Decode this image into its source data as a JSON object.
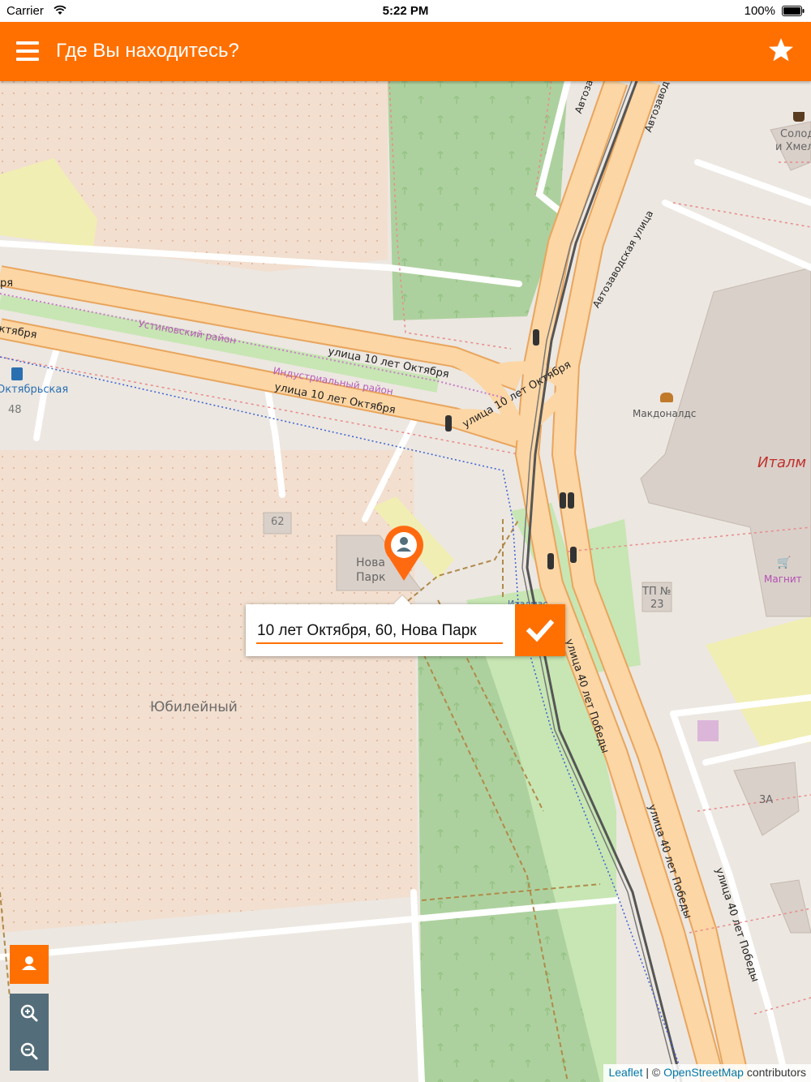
{
  "status_bar": {
    "carrier": "Carrier",
    "time": "5:22 PM",
    "battery": "100%"
  },
  "header": {
    "title": "Где Вы находитесь?",
    "menu_icon": "hamburger-icon",
    "favorite_icon": "star-icon"
  },
  "popup": {
    "address": "10 лет Октября, 60, Нова Парк",
    "confirm_icon": "checkmark-icon"
  },
  "controls": {
    "locate_icon": "user-location-icon",
    "zoom_in_icon": "zoom-in-icon",
    "zoom_out_icon": "zoom-out-icon"
  },
  "attribution": {
    "leaflet": "Leaflet",
    "separator": "| ©",
    "osm": "OpenStreetMap",
    "suffix": "contributors"
  },
  "map_labels": {
    "yubileyny": "Юбилейный",
    "nova_park_1": "Нова",
    "nova_park_2": "Парк",
    "house_62": "62",
    "house_48": "48",
    "oktyabrskaya": "Октябрьская",
    "ustinovsky": "Устиновский район",
    "industrialny": "Индустриальный район",
    "street_10_let_1": "улица 10 лет Октября",
    "street_10_let_2": "улица 10 лет Октября",
    "street_10_let_3": "улица 10 лет Октября",
    "street_10_let_left1": "ря",
    "street_10_let_left2": "ктября",
    "avtozavodskaya": "Автозаводская улица",
    "avtozav_short1": "Автоза",
    "avtozav_short2": "Автозавод",
    "mcdonalds": "Макдоналдс",
    "italmas": "Италм",
    "magnit": "Магнит",
    "tp_23_1": "ТП №",
    "tp_23_2": "23",
    "street_40_let_1": "улица 40 лет Победы",
    "street_40_let_2": "улица 40 лет Победы",
    "street_40_let_3": "улица 40 лет Победы",
    "italmas_stop": "Италмас",
    "house_3a": "3А",
    "solod_1": "Солод",
    "solod_2": "и Хмел"
  },
  "colors": {
    "accent": "#ff7000",
    "control_gray": "#546d7a",
    "road_orange": "#fcd6a4",
    "park_green": "#add19e",
    "residential": "#ece7e1"
  }
}
